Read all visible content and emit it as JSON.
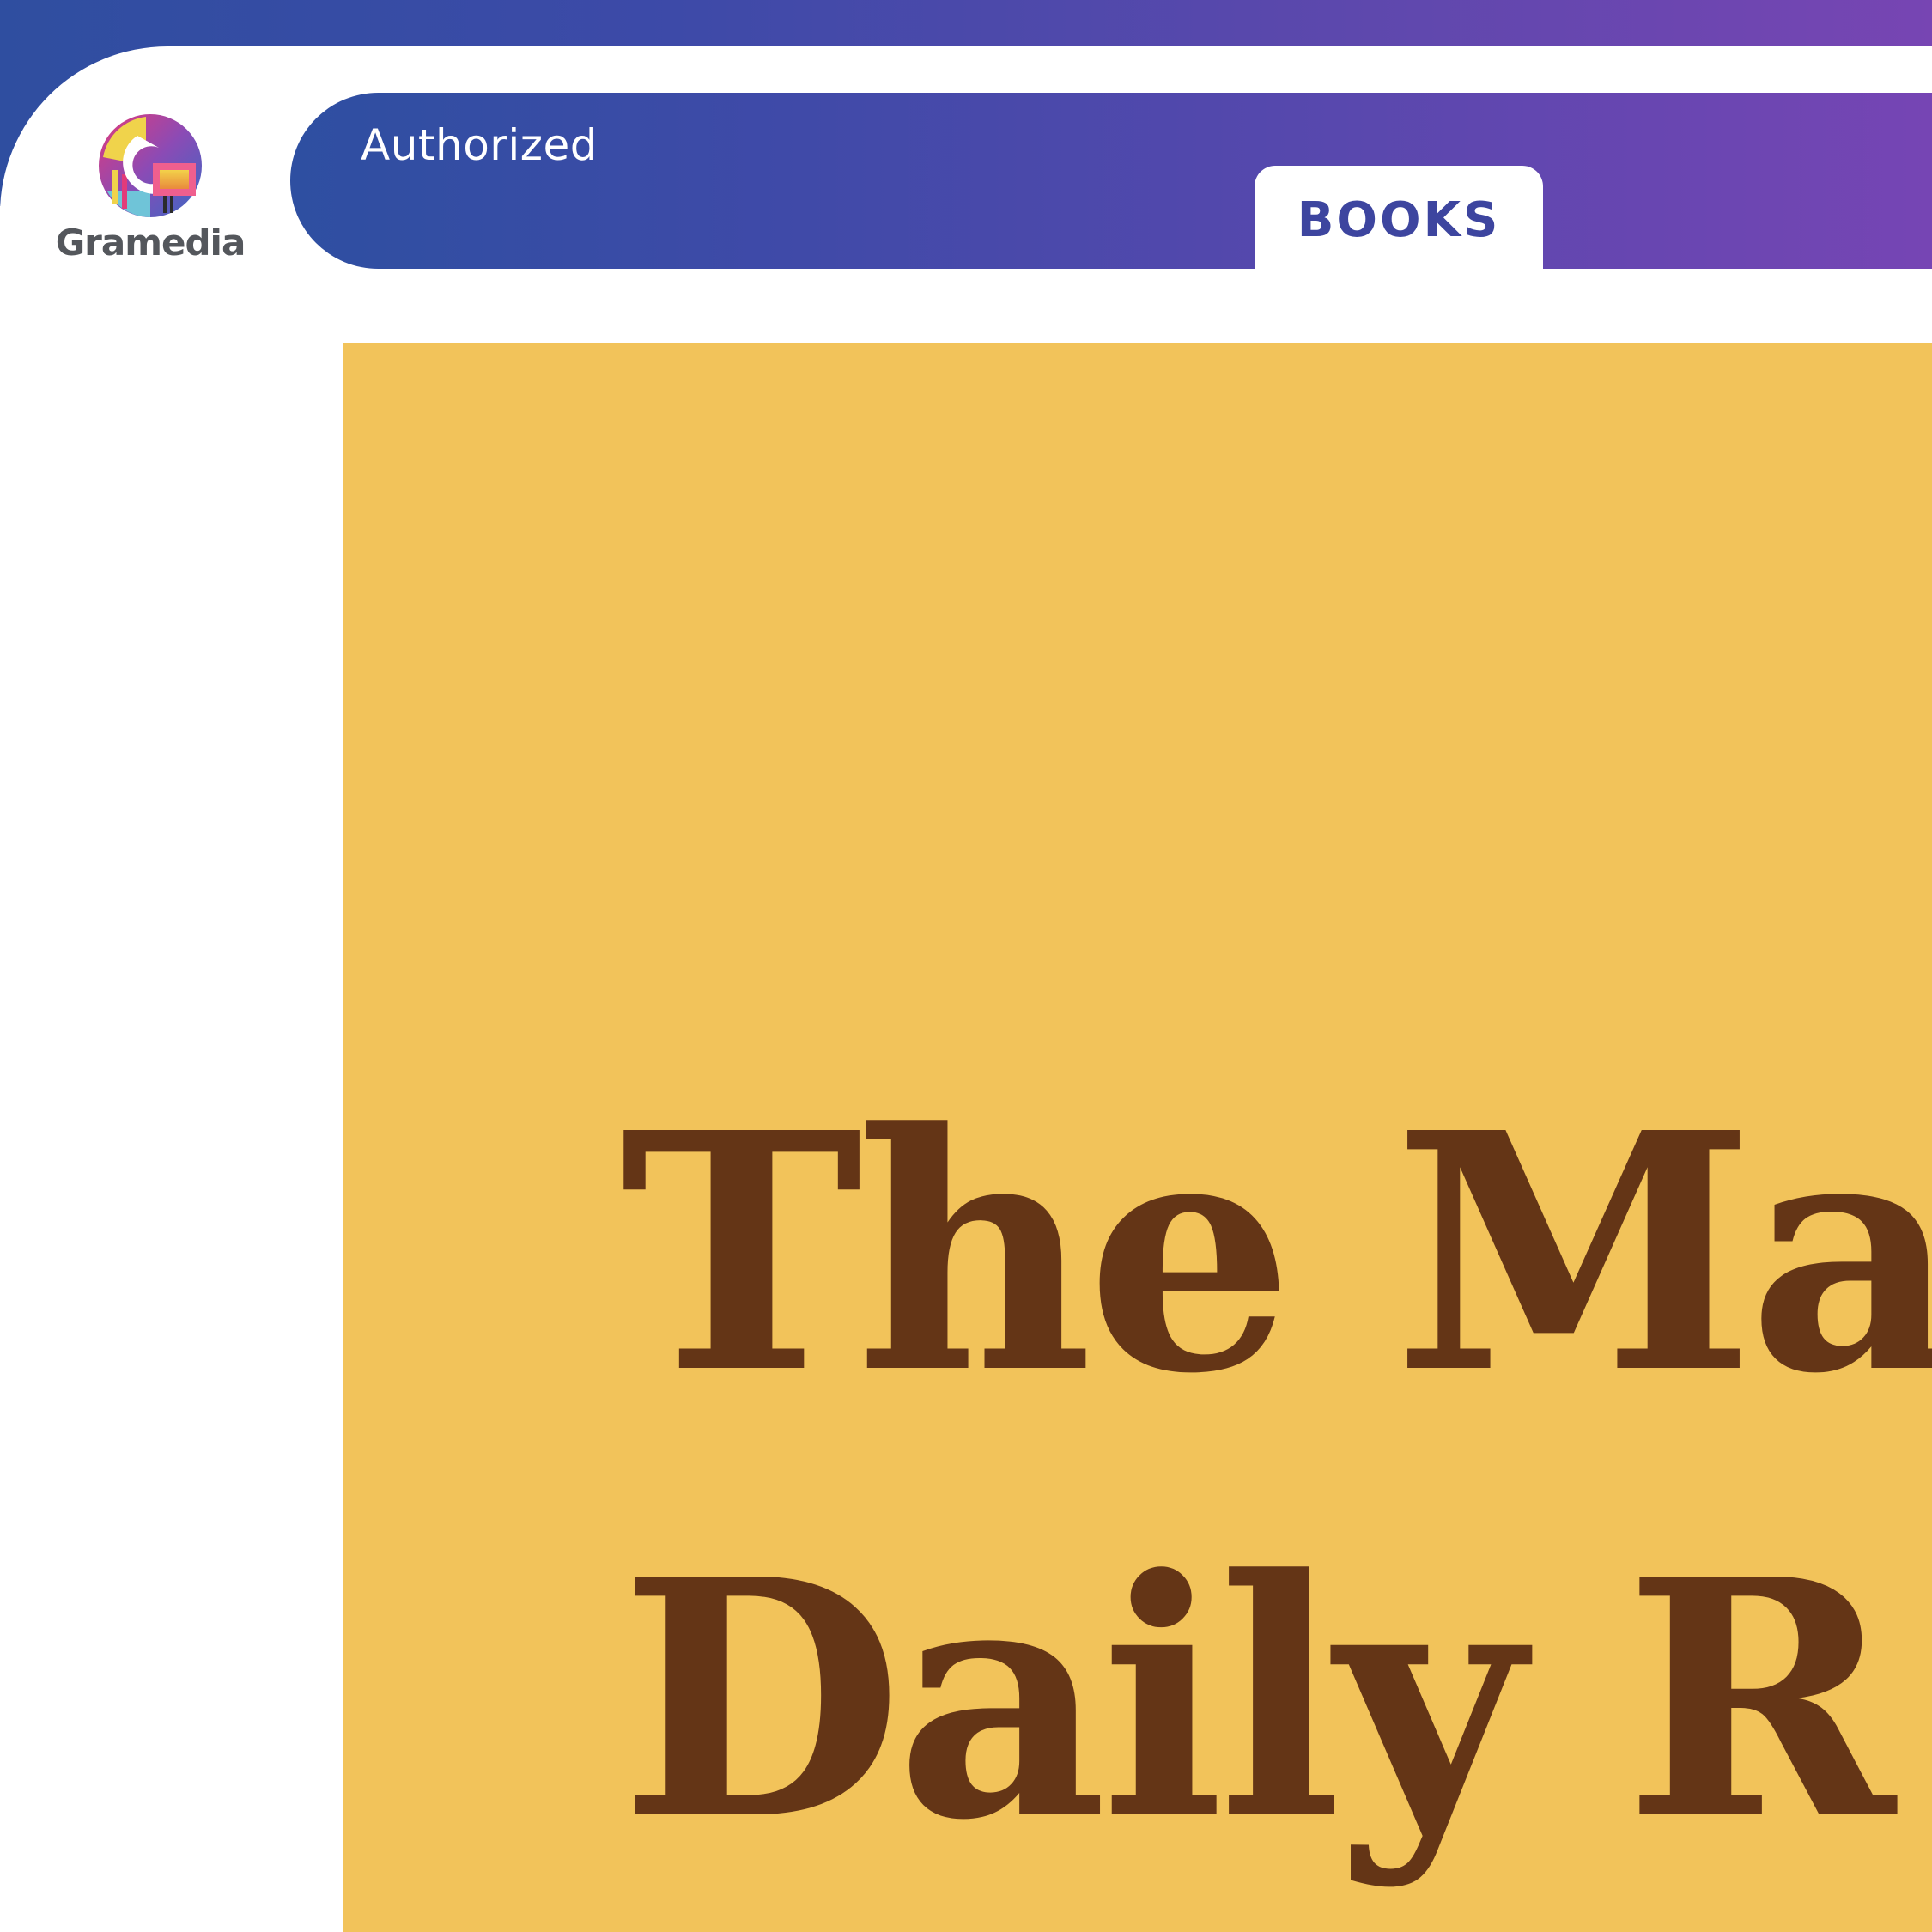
{
  "brand": {
    "name": "Gramedia",
    "logo_icon": "gramedia-g-logo-icon"
  },
  "header": {
    "status_text": "Authorized",
    "category_tab": "BOOKS"
  },
  "cover": {
    "title": "The Ma\nDaily R",
    "background": "#f2c35a",
    "text_color": "#643516"
  },
  "colors": {
    "gradient_start": "#2f4ea0",
    "gradient_end": "#7745b3",
    "tab_text": "#3d459f"
  }
}
